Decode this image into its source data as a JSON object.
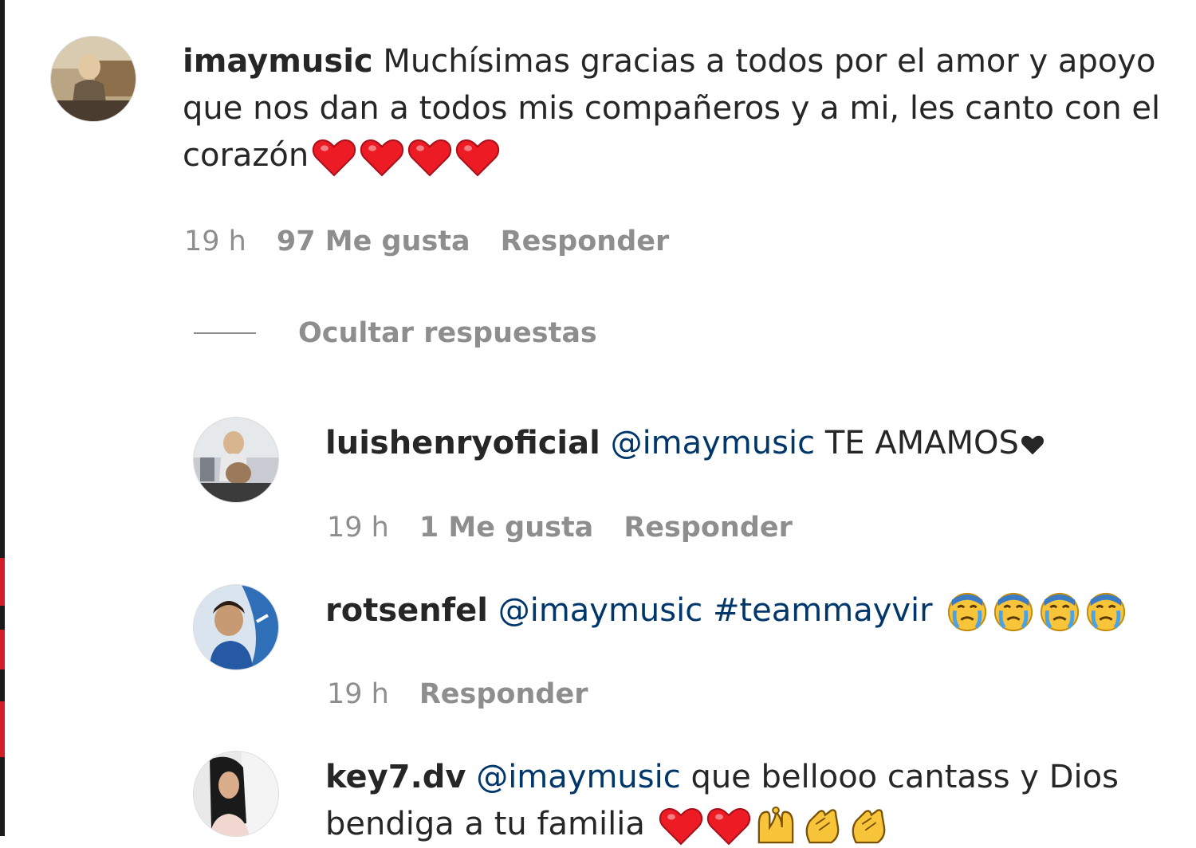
{
  "comments": {
    "main": {
      "username": "imaymusic",
      "text": "Muchísimas gracias a todos por el amor y apoyo que nos dan a todos mis compañeros y a mi, les canto con el corazón",
      "emojis": [
        "heart-icon",
        "heart-icon",
        "heart-icon",
        "heart-icon"
      ],
      "time": "19 h",
      "likes": "97 Me gusta",
      "reply": "Responder"
    },
    "hide_replies": "Ocultar respuestas",
    "replies": [
      {
        "username": "luishenryoficial",
        "mention": "@imaymusic",
        "text": "TE AMAMOS",
        "emojis": [
          "black-heart-icon"
        ],
        "time": "19 h",
        "likes": "1 Me gusta",
        "reply": "Responder"
      },
      {
        "username": "rotsenfel",
        "mention": "@imaymusic",
        "hashtag": "#teammayvir",
        "emojis": [
          "crying-face-icon",
          "crying-face-icon",
          "crying-face-icon",
          "crying-face-icon"
        ],
        "time": "19 h",
        "reply": "Responder"
      },
      {
        "username": "key7.dv",
        "mention": "@imaymusic",
        "text": "que bellooo cantass y Dios bendiga a tu familia",
        "emojis": [
          "heart-icon",
          "heart-icon",
          "raised-hands-icon",
          "clapping-hands-icon",
          "clapping-hands-icon"
        ]
      }
    ]
  },
  "colors": {
    "text": "#262626",
    "muted": "#8e8e8e",
    "mention": "#00376b",
    "heart": "#ed1c24"
  }
}
